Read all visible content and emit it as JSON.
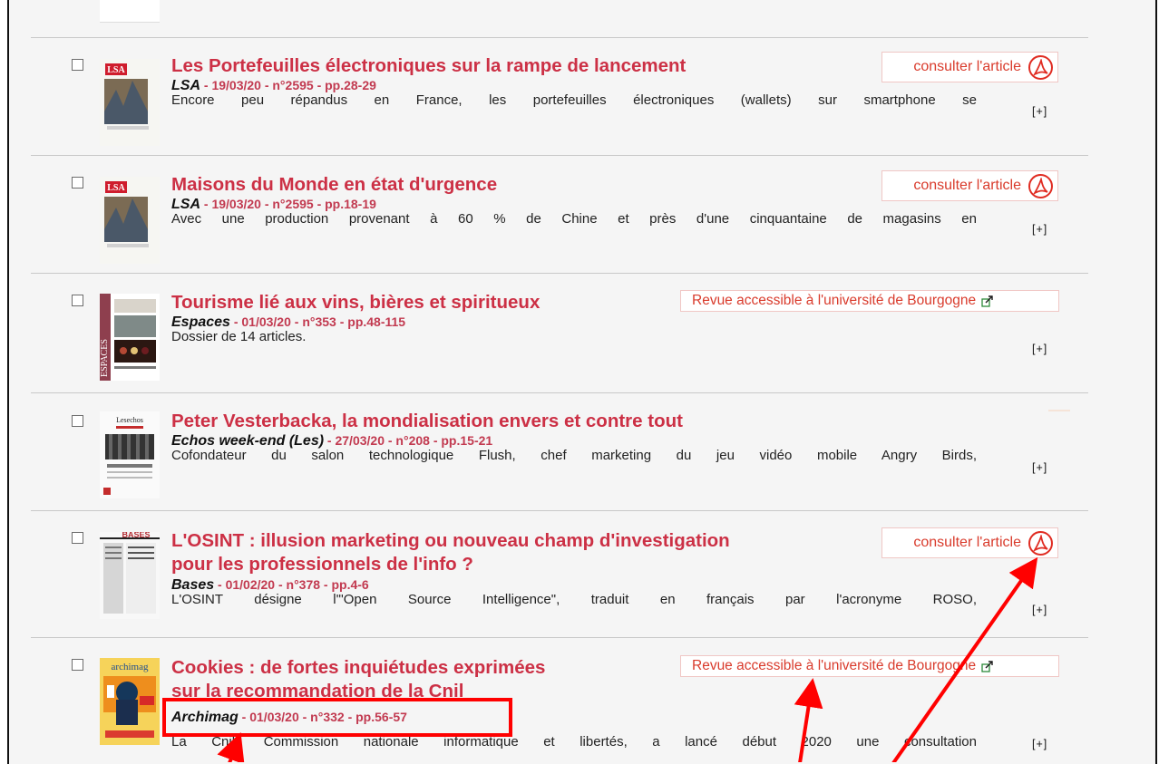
{
  "articles": [
    {
      "title_line1": "Les Portefeuilles électroniques sur la rampe de lancement",
      "title_line2": "",
      "publication": "LSA",
      "details": " - 19/03/20 - n°2595 - pp.28-29",
      "summary": "Encore peu répandus en France, les portefeuilles électroniques (wallets) sur smartphone se",
      "action": "consulter l'article",
      "expand": "[+]"
    },
    {
      "title_line1": "Maisons du Monde en état d'urgence",
      "title_line2": "",
      "publication": "LSA",
      "details": " - 19/03/20 - n°2595 - pp.18-19",
      "summary": "Avec une production provenant à 60 % de Chine et près d'une cinquantaine de magasins en",
      "action": "consulter l'article",
      "expand": "[+]"
    },
    {
      "title_line1": "Tourisme lié aux vins, bières et spiritueux",
      "title_line2": "",
      "publication": "Espaces",
      "details": " - 01/03/20 - n°353 - pp.48-115",
      "summary": "Dossier de 14 articles.",
      "action": "Revue accessible à l'université de Bourgogne",
      "expand": "[+]"
    },
    {
      "title_line1": "Peter Vesterbacka, la mondialisation envers et contre tout",
      "title_line2": "",
      "publication": "Echos week-end (Les)",
      "details": " - 27/03/20 - n°208 - pp.15-21",
      "summary": "Cofondateur du salon technologique Flush, chef marketing du jeu vidéo mobile Angry Birds,",
      "action": "",
      "expand": "[+]"
    },
    {
      "title_line1": "L'OSINT : illusion marketing ou nouveau champ d'investigation",
      "title_line2": "pour les professionnels de l'info ?",
      "publication": "Bases",
      "details": " - 01/02/20 - n°378 - pp.4-6",
      "summary": "L'OSINT désigne l'\"Open Source Intelligence\", traduit en français par l'acronyme ROSO,",
      "action": "consulter l'article",
      "expand": "[+]"
    },
    {
      "title_line1": "Cookies : de fortes inquiétudes exprimées",
      "title_line2": "sur la recommandation de la Cnil",
      "publication": "Archimag",
      "details": " - 01/03/20 - n°332 - pp.56-57",
      "summary": "La Cnil, Commission nationale informatique et libertés, a lancé début 2020 une consultation",
      "action": "Revue accessible à l'université de Bourgogne",
      "expand": "[+]"
    }
  ],
  "thumbnail_texts": {
    "lsa": "LSA",
    "espaces": "ESPACES",
    "echos": "Lesechos",
    "bases": "BASES",
    "archimag": "archimag"
  },
  "colors": {
    "title": "#cc3045",
    "meta": "#c23a50",
    "action": "#d93b2c",
    "annotation": "#ff0000",
    "background": "#f5f5f5"
  },
  "icons": {
    "pdf": "acrobat-pdf-icon",
    "external": "external-link-icon",
    "checkbox": "checkbox"
  }
}
